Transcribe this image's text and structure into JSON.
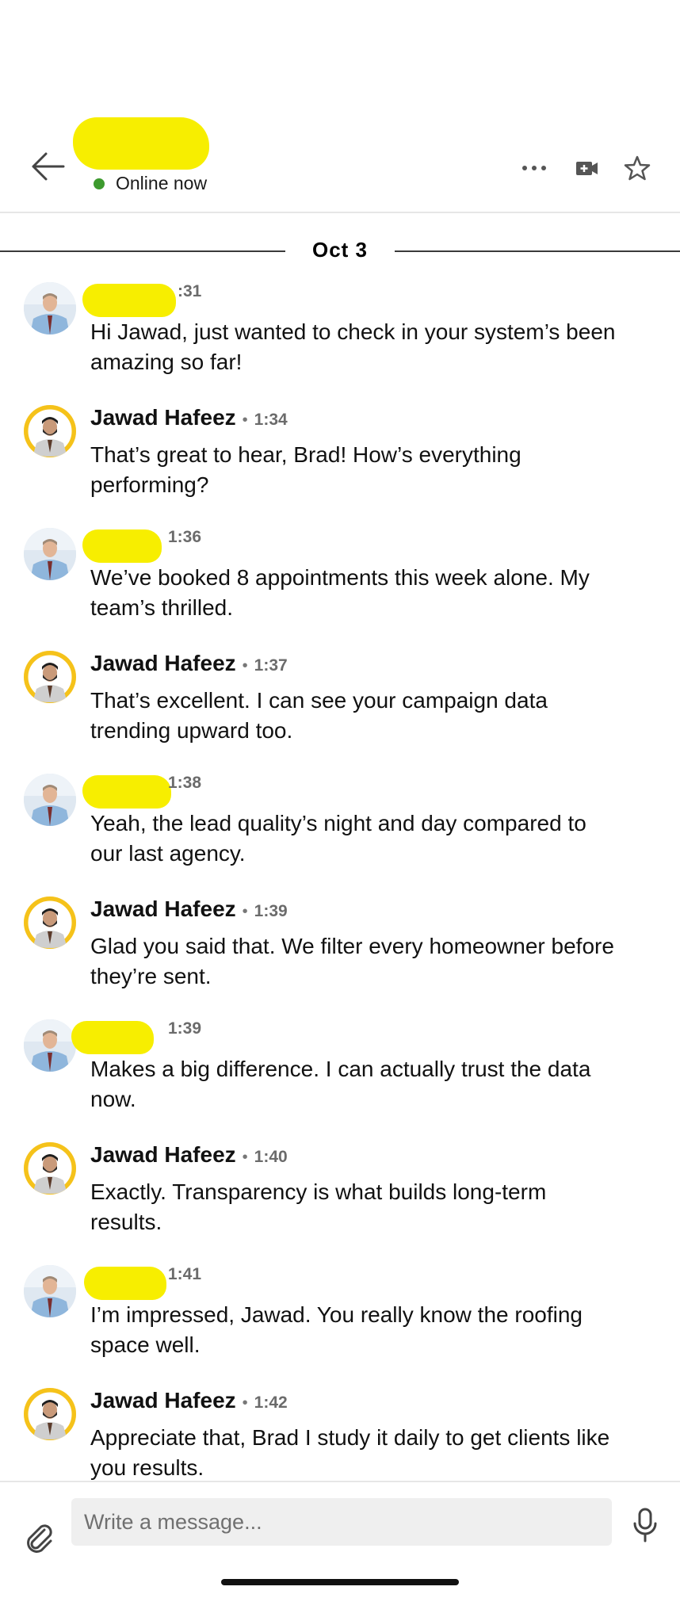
{
  "header": {
    "status_text": "Online now",
    "status_color": "#3d9a2e",
    "redaction_color": "#f7ee00",
    "icons": [
      "back-arrow-icon",
      "more-options-icon",
      "video-call-icon",
      "star-icon"
    ]
  },
  "date_separator": "Oct 3",
  "messages": [
    {
      "sender": "",
      "redacted": true,
      "time": ":31",
      "text": "Hi Jawad, just wanted to check in your system’s been amazing so far!"
    },
    {
      "sender": "Jawad Hafeez",
      "redacted": false,
      "time": "1:34",
      "text": "That’s great to hear, Brad! How’s everything performing?"
    },
    {
      "sender": "",
      "redacted": true,
      "time": "1:36",
      "text": "We’ve booked 8 appointments this week alone. My team’s thrilled."
    },
    {
      "sender": "Jawad Hafeez",
      "redacted": false,
      "time": "1:37",
      "text": "That’s excellent. I can see your campaign data trending upward too."
    },
    {
      "sender": "",
      "redacted": true,
      "time": "1:38",
      "text": "Yeah, the lead quality’s night and day compared to our last agency."
    },
    {
      "sender": "Jawad Hafeez",
      "redacted": false,
      "time": "1:39",
      "text": "Glad you said that. We filter every homeowner before they’re sent."
    },
    {
      "sender": "",
      "redacted": true,
      "time": "1:39",
      "text": "Makes a big difference. I can actually trust the data now."
    },
    {
      "sender": "Jawad Hafeez",
      "redacted": false,
      "time": "1:40",
      "text": "Exactly. Transparency is what builds long-term results."
    },
    {
      "sender": "",
      "redacted": true,
      "time": "1:41",
      "text": "I’m impressed, Jawad. You really know the roofing space well."
    },
    {
      "sender": "Jawad Hafeez",
      "redacted": false,
      "time": "1:42",
      "text": "Appreciate that, Brad I study it daily to get clients like you results."
    }
  ],
  "composer": {
    "placeholder": "Write a message...",
    "icons": [
      "paperclip-icon",
      "microphone-icon"
    ]
  }
}
